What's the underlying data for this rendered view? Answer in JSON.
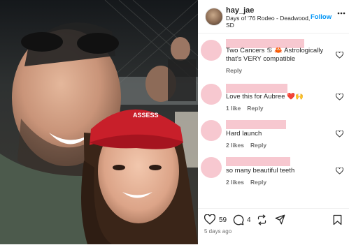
{
  "post": {
    "username": "hay_jae",
    "location": "Days of '76 Rodeo - Deadwood, SD",
    "follow_label": "Follow",
    "timestamp": "5 days ago",
    "like_count": "59",
    "comment_count": "4"
  },
  "comments": [
    {
      "text": "Two Cancers ♋ 🦀 Astrologically that's VERY compatible",
      "meta": [
        "Reply"
      ]
    },
    {
      "text": "Love this for Aubree ❤️🙌",
      "meta": [
        "1 like",
        "Reply"
      ]
    },
    {
      "text": "Hard launch",
      "meta": [
        "2 likes",
        "Reply"
      ]
    },
    {
      "text": "so many beautiful teeth",
      "meta": [
        "2 likes",
        "Reply"
      ]
    }
  ],
  "colors": {
    "redacted_pink": "#f7c8d0",
    "follow_blue": "#0095f6",
    "text_primary": "#262626",
    "text_secondary": "#737373"
  },
  "icons": [
    "more-options-icon",
    "heart-icon",
    "comment-icon",
    "share-icon",
    "send-icon",
    "bookmark-icon"
  ]
}
